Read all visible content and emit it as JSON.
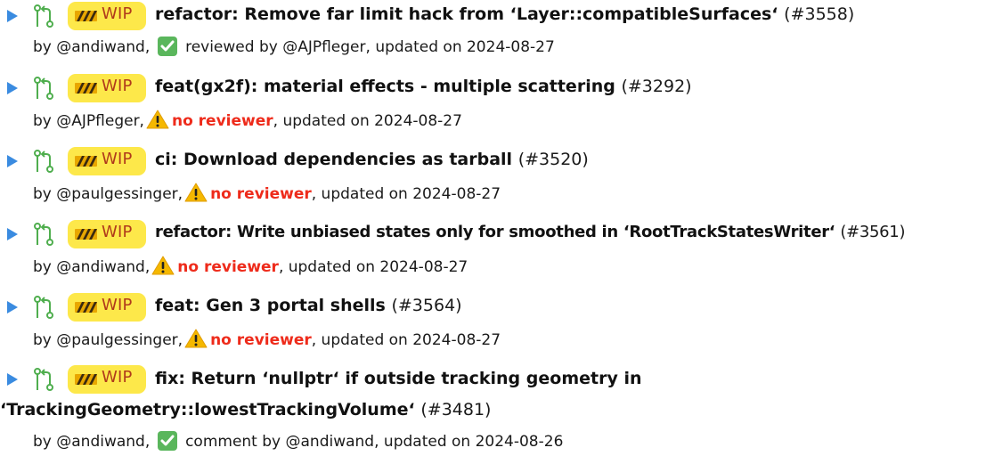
{
  "colors": {
    "arrow": "#3a8be0",
    "mr_icon": "#4fae4e",
    "wip_badge_bg": "#fde84a",
    "wip_text": "#b03a1b",
    "check_bg": "#5ab65c",
    "warning": "#f5b800",
    "no_reviewer": "#ee2b1b"
  },
  "icons": {
    "expand": "triangle-right-icon",
    "merge_request": "merge-request-icon",
    "wip": "construction-cone-icon",
    "approved": "check-mark-box-icon",
    "warning": "warning-icon"
  },
  "wip_label": "WIP",
  "prs": [
    {
      "title": "refactor: Remove far limit hack from ‘Layer::compatibleSurfaces‘",
      "number": "(#3558)",
      "author_prefix": "by @andiwand,",
      "status_type": "check",
      "status_text": "reviewed by @AJPfleger",
      "updated": ", updated on 2024-08-27"
    },
    {
      "title": "feat(gx2f): material effects - multiple scattering",
      "number": "(#3292)",
      "author_prefix": "by @AJPfleger,",
      "status_type": "warning",
      "status_text": "no reviewer",
      "updated": ", updated on 2024-08-27"
    },
    {
      "title": "ci: Download dependencies as tarball",
      "number": "(#3520)",
      "author_prefix": "by @paulgessinger,",
      "status_type": "warning",
      "status_text": "no reviewer",
      "updated": ", updated on 2024-08-27"
    },
    {
      "title": "refactor: Write unbiased states only for smoothed in ‘RootTrackStatesWriter‘",
      "number": "(#3561)",
      "author_prefix": "by @andiwand,",
      "status_type": "warning",
      "status_text": "no reviewer",
      "updated": ", updated on 2024-08-27"
    },
    {
      "title": "feat: Gen 3 portal shells",
      "number": "(#3564)",
      "author_prefix": "by @paulgessinger,",
      "status_type": "warning",
      "status_text": "no reviewer",
      "updated": ", updated on 2024-08-27"
    },
    {
      "title": "fix: Return ‘nullptr‘ if outside tracking geometry in ‘TrackingGeometry::lowestTrackingVolume‘",
      "number": "(#3481)",
      "author_prefix": "by @andiwand,",
      "status_type": "check",
      "status_text": "comment by @andiwand",
      "updated": ", updated on 2024-08-26"
    }
  ]
}
